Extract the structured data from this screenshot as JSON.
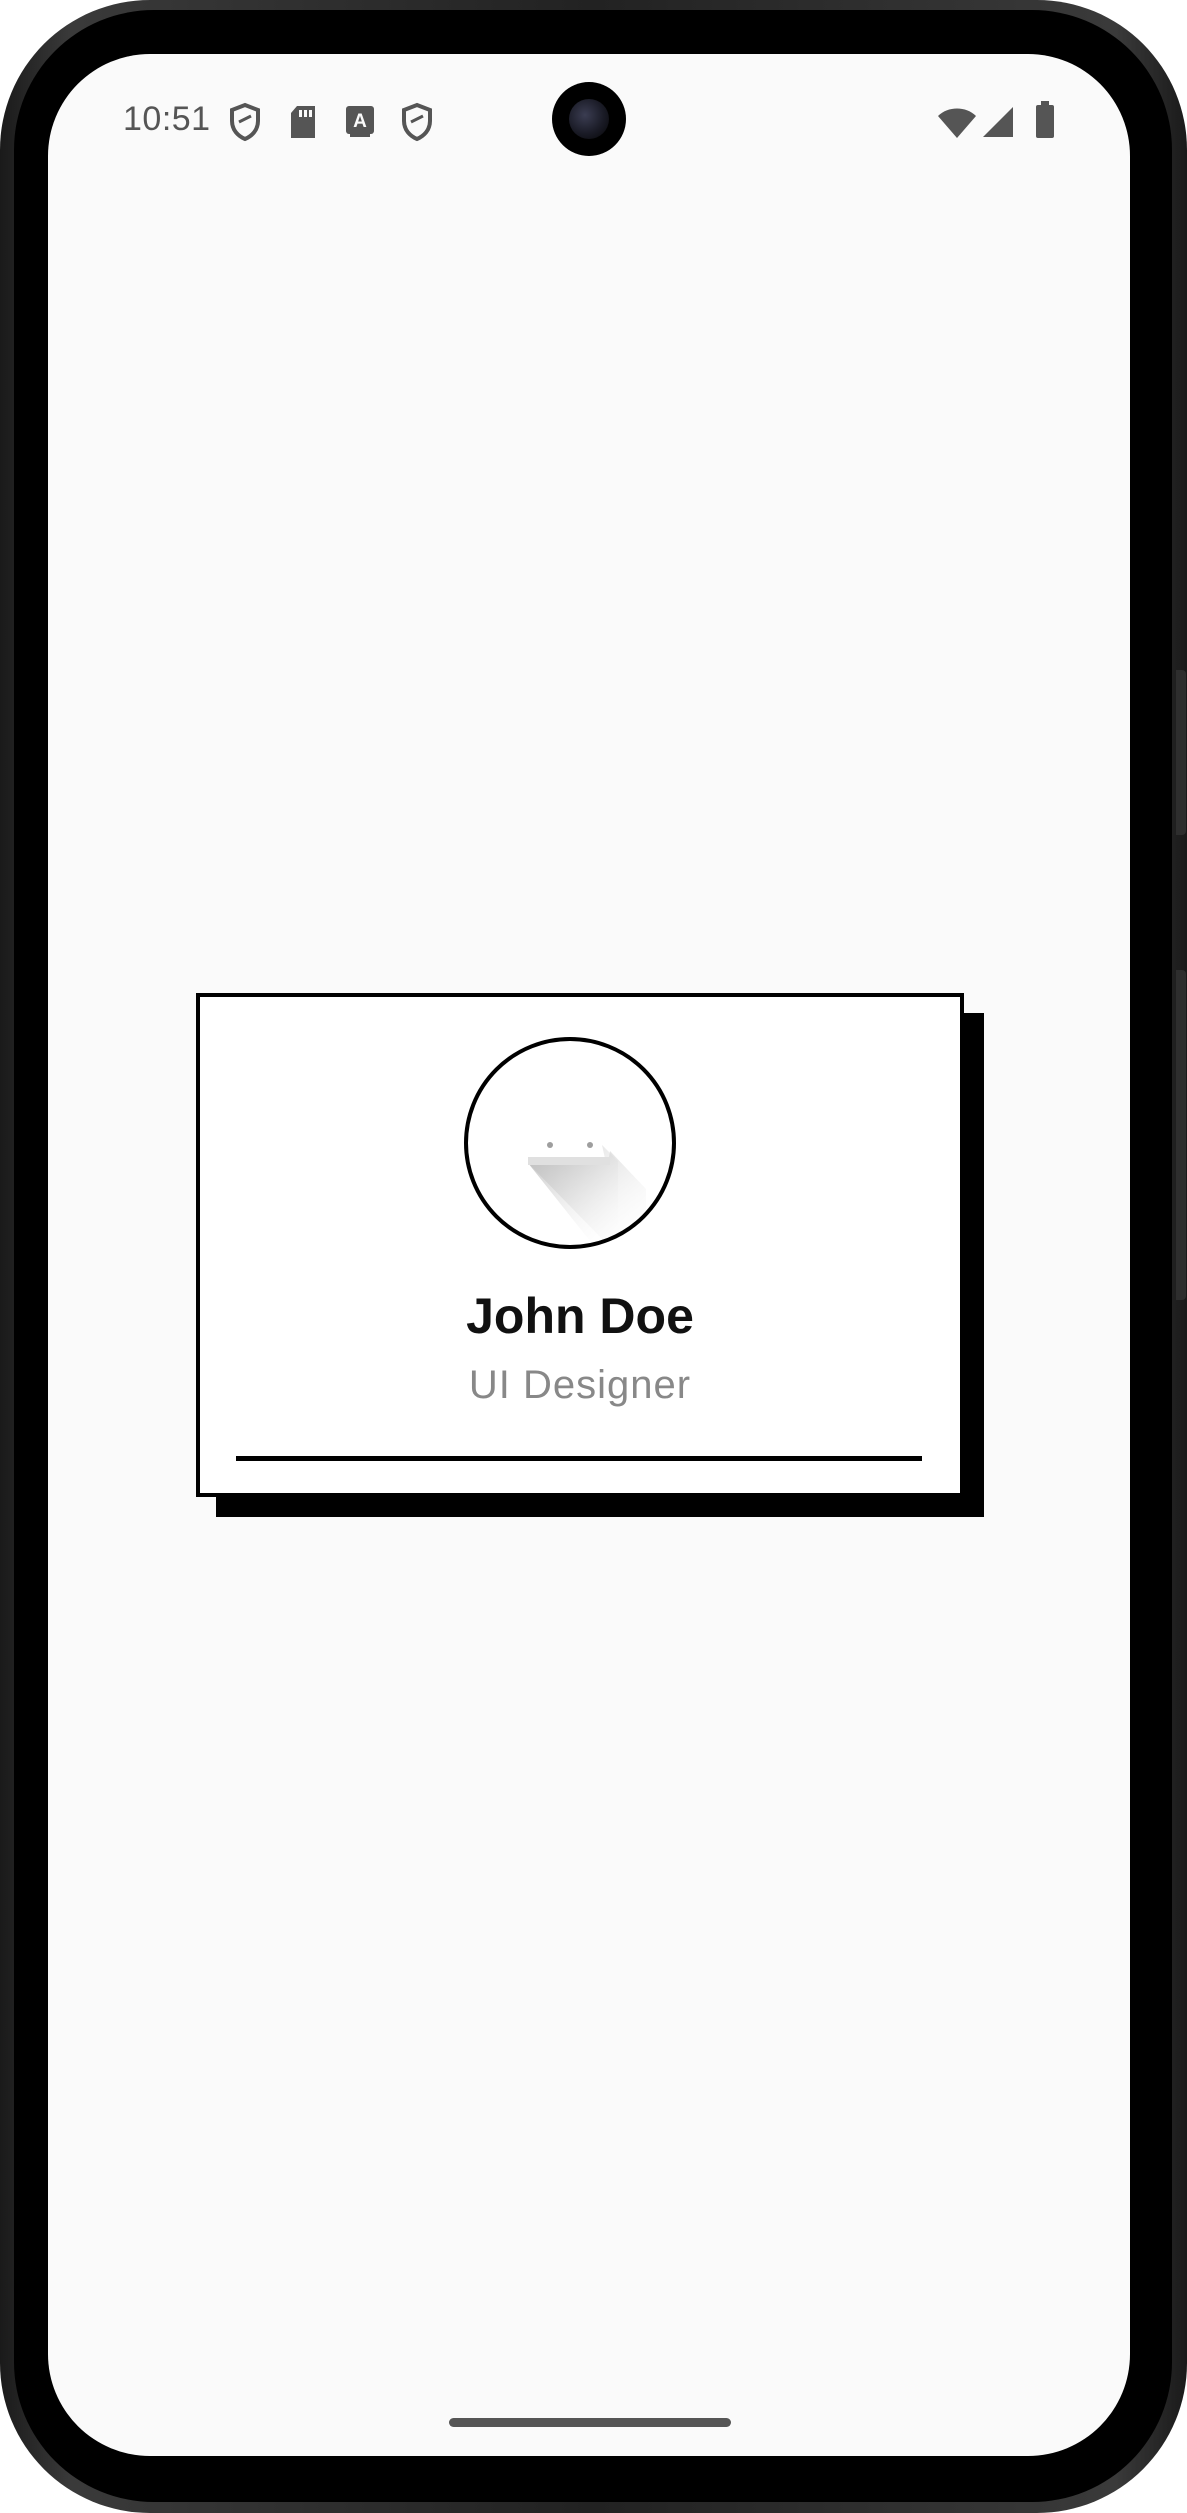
{
  "status_bar": {
    "time": "10:51",
    "left_icons": [
      "shield-icon",
      "sd-card-icon",
      "font-a-icon",
      "shield-icon"
    ],
    "right_icons": [
      "wifi-icon",
      "signal-icon",
      "battery-icon"
    ]
  },
  "profile_card": {
    "name": "John Doe",
    "title": "UI Designer",
    "avatar_icon": "avatar-placeholder-icon"
  },
  "colors": {
    "screen_background": "#fafafa",
    "card_background": "#ffffff",
    "border": "#000000",
    "name_text": "#111111",
    "title_text": "#888888"
  }
}
